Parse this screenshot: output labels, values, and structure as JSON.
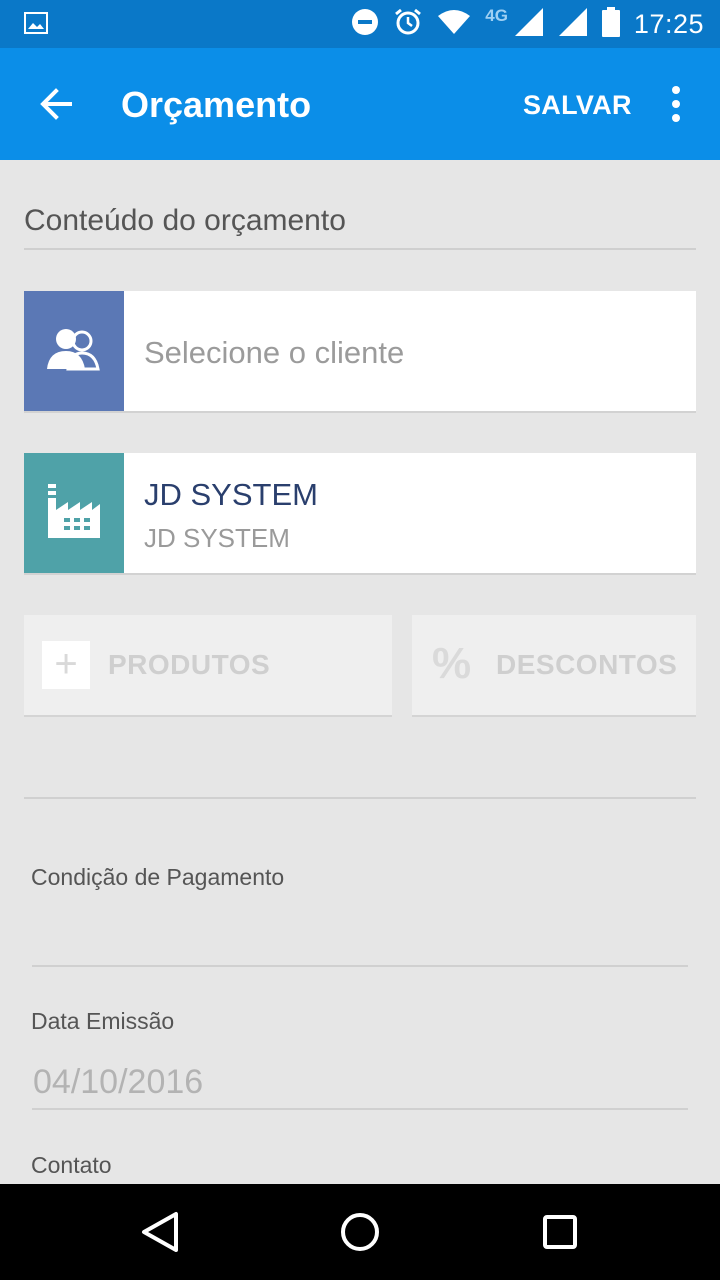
{
  "status_bar": {
    "time": "17:25",
    "network": "4G",
    "icons": [
      "image-icon",
      "dnd-icon",
      "alarm-icon",
      "wifi-icon",
      "signal-icon",
      "signal-icon",
      "battery-icon"
    ]
  },
  "app_bar": {
    "title": "Orçamento",
    "save_label": "SALVAR",
    "back_icon": "arrow-left-icon",
    "more_icon": "more-vert-icon",
    "color": "#0b8ee8"
  },
  "content": {
    "section_title": "Conteúdo do orçamento",
    "client_card": {
      "placeholder": "Selecione o cliente",
      "icon": "users-icon",
      "icon_bg": "#5b78b5"
    },
    "company_card": {
      "name": "JD SYSTEM",
      "subtitle": "JD SYSTEM",
      "icon": "factory-icon",
      "icon_bg": "#4fa2a8"
    },
    "buttons": {
      "products_label": "PRODUTOS",
      "products_icon_glyph": "+",
      "discounts_label": "DESCONTOS",
      "discounts_icon_glyph": "%"
    }
  },
  "form": {
    "payment_condition": {
      "label": "Condição de Pagamento",
      "value": ""
    },
    "issue_date": {
      "label": "Data Emissão",
      "value": "04/10/2016"
    },
    "contact": {
      "label": "Contato"
    }
  },
  "nav_bar": {
    "icons": [
      "back-triangle-icon",
      "home-circle-icon",
      "recents-square-icon"
    ]
  }
}
